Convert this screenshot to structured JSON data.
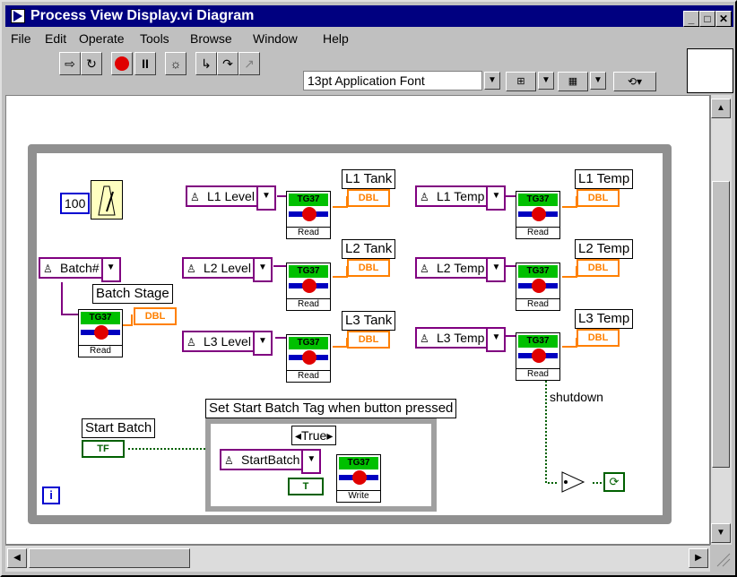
{
  "window": {
    "title": "Process View Display.vi Diagram",
    "buttons": {
      "minimize": "_",
      "maximize": "□",
      "close": "✕"
    }
  },
  "menu": [
    "File",
    "Edit",
    "Operate",
    "Tools",
    "Browse",
    "Window",
    "Help"
  ],
  "toolbar": {
    "font_value": "13pt Application Font"
  },
  "diagram": {
    "loop_const": "100",
    "batch_tag": "Batch#",
    "batch_stage_label": "Batch Stage",
    "levels": [
      {
        "tag": "L1 Level",
        "label": "L1 Tank"
      },
      {
        "tag": "L2 Level",
        "label": "L2 Tank"
      },
      {
        "tag": "L3 Level",
        "label": "L3 Tank"
      }
    ],
    "temps": [
      {
        "tag": "L1 Temp",
        "label": "L1 Temp"
      },
      {
        "tag": "L2 Temp",
        "label": "L2 Temp"
      },
      {
        "tag": "L3 Temp",
        "label": "L3 Temp"
      }
    ],
    "dbl": "DBL",
    "tg": "TG37",
    "read": "Read",
    "write": "Write",
    "start_batch_label": "Start Batch",
    "tf": "TF",
    "case_label": "Set Start Batch Tag when button pressed",
    "case_selector": "True",
    "start_batch_tag": "StartBatch",
    "shutdown_label": "shutdown",
    "info_icon": "i"
  },
  "colors": {
    "titlebar": "#000080",
    "dbl": "#ff8000",
    "bool": "#006000",
    "tag": "#800080",
    "numeric": "#0000d0"
  }
}
